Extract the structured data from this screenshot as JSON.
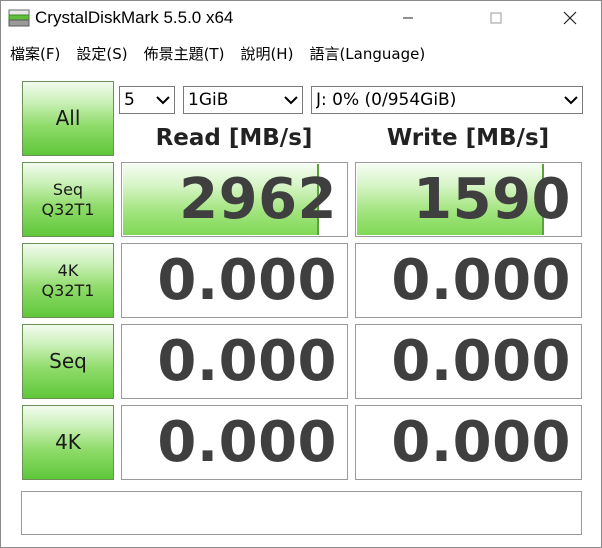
{
  "window": {
    "title": "CrystalDiskMark 5.5.0 x64",
    "icon": "crystaldiskmark-app-icon",
    "controls": [
      "minimize-icon",
      "maximize-icon",
      "close-icon"
    ]
  },
  "menu": [
    {
      "label": "檔案(F)"
    },
    {
      "label": "設定(S)"
    },
    {
      "label": "佈景主題(T)"
    },
    {
      "label": "說明(H)"
    },
    {
      "label": "語言(Language)"
    }
  ],
  "toolbar": {
    "all_label": "All",
    "count_select": "5",
    "size_select": "1GiB",
    "drive_select": "J: 0% (0/954GiB)"
  },
  "headers": {
    "read": "Read [MB/s]",
    "write": "Write [MB/s]"
  },
  "tests": [
    {
      "line1": "Seq",
      "line2": "Q32T1",
      "read": "2962",
      "write": "1590",
      "read_fill_fraction": 0.88,
      "write_fill_fraction": 0.84
    },
    {
      "line1": "4K",
      "line2": "Q32T1",
      "read": "0.000",
      "write": "0.000",
      "read_fill_fraction": 0,
      "write_fill_fraction": 0
    },
    {
      "line1": "Seq",
      "line2": "",
      "read": "0.000",
      "write": "0.000",
      "read_fill_fraction": 0,
      "write_fill_fraction": 0
    },
    {
      "line1": "4K",
      "line2": "",
      "read": "0.000",
      "write": "0.000",
      "read_fill_fraction": 0,
      "write_fill_fraction": 0
    }
  ],
  "comment": "",
  "colors": {
    "button_green": "#5fc73a",
    "bar_green": "#7fd855",
    "value_text": "#3f3f3f"
  }
}
